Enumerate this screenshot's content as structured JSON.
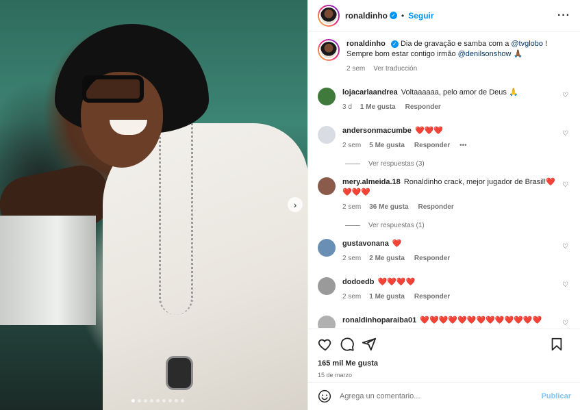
{
  "header": {
    "username": "ronaldinho",
    "separator": "•",
    "follow_label": "Seguir",
    "more_icon": "more-horizontal-icon"
  },
  "caption": {
    "username": "ronaldinho",
    "text_pre": "Dia de gravação e samba com a ",
    "mention1": "@tvglobo",
    "text_mid": " ! Sempre bom estar contigo irmão ",
    "mention2": "@denilsonshow",
    "emoji": "🙏🏾",
    "time": "2 sem",
    "translate_label": "Ver traducción"
  },
  "comments": [
    {
      "username": "lojacarlaandrea",
      "text": "Voltaaaaaa, pelo amor de Deus 🙏",
      "time": "3 d",
      "likes": "1 Me gusta",
      "reply": "Responder",
      "avatar_color": "#3f7a3a"
    },
    {
      "username": "andersonmacumbe",
      "text": "❤️❤️❤️",
      "time": "2 sem",
      "likes": "5 Me gusta",
      "reply": "Responder",
      "options": "•••",
      "view_replies": "Ver respuestas (3)",
      "avatar_color": "#d9dde3"
    },
    {
      "username": "mery.almeida.18",
      "text": "Ronaldinho crack, mejor jugador de Brasil!❤️❤️❤️❤️",
      "time": "2 sem",
      "likes": "36 Me gusta",
      "reply": "Responder",
      "view_replies": "Ver respuestas (1)",
      "avatar_color": "#8a5a4a"
    },
    {
      "username": "gustavonana",
      "text": "❤️",
      "time": "2 sem",
      "likes": "2 Me gusta",
      "reply": "Responder",
      "avatar_color": "#6a8fb5"
    },
    {
      "username": "dodoedb",
      "text": "❤️❤️❤️❤️",
      "time": "2 sem",
      "likes": "1 Me gusta",
      "reply": "Responder",
      "avatar_color": "#9a9a9a"
    },
    {
      "username": "ronaldinhoparaiba01",
      "text": "❤️❤️❤️❤️❤️❤️❤️❤️❤️❤️❤️❤️❤️",
      "avatar_color": "#b0b0b0"
    }
  ],
  "actions": {
    "likes": "165 mil Me gusta",
    "date": "15 de marzo"
  },
  "composer": {
    "placeholder": "Agrega un comentario...",
    "publish_label": "Publicar"
  },
  "carousel": {
    "total": 9,
    "active": 1
  }
}
